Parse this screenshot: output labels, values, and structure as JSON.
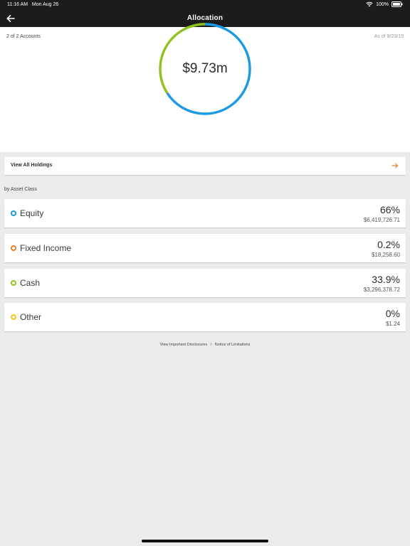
{
  "status_bar": {
    "time": "11:16 AM",
    "date": "Mon Aug 26",
    "battery": "100%"
  },
  "nav": {
    "title": "Allocation"
  },
  "summary": {
    "accounts": "2 of 2 Accounts",
    "as_of": "As of 8/23/19",
    "total": "$9.73m"
  },
  "view_all": {
    "label": "View All Holdings"
  },
  "section": {
    "label": "by Asset Class"
  },
  "assets": [
    {
      "name": "Equity",
      "percent": "66%",
      "amount": "$6,419,726.71",
      "color": "#1b9ae4"
    },
    {
      "name": "Fixed Income",
      "percent": "0.2%",
      "amount": "$18,258.60",
      "color": "#f07d26"
    },
    {
      "name": "Cash",
      "percent": "33.9%",
      "amount": "$3,296,378.72",
      "color": "#8dc21f"
    },
    {
      "name": "Other",
      "percent": "0%",
      "amount": "$1.24",
      "color": "#f2c21b"
    }
  ],
  "chart_data": {
    "type": "pie",
    "categories": [
      "Equity",
      "Fixed Income",
      "Cash",
      "Other"
    ],
    "values": [
      66,
      0.2,
      33.9,
      0
    ],
    "colors": [
      "#1b9ae4",
      "#f07d26",
      "#8dc21f",
      "#f2c21b"
    ],
    "title": "$9.73m"
  },
  "footer": {
    "disclosures": "View Important Disclosures",
    "separator": "/",
    "limitations": "Notice of Limitations"
  },
  "colors": {
    "header_bg": "#1c1c1c",
    "page_bg": "#ebebeb",
    "accent_arrow": "#f07d26"
  }
}
